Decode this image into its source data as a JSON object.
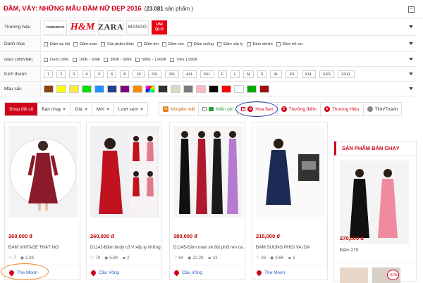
{
  "header": {
    "title": "ĐẦM, VÁY: NHỮNG MẪU ĐẦM NỮ ĐẸP 2016",
    "count_prefix": "(",
    "count": "23.081",
    "count_suffix": " sản phẩm )"
  },
  "filters": {
    "brand": {
      "label": "Thương hiệu",
      "items": [
        "FOREVER 21",
        "H&M",
        "ZARA",
        "MANGO",
        "UNI QLO"
      ]
    },
    "category": {
      "label": "Danh mục",
      "items": [
        "Đầm dạ hội",
        "Đầm maxi",
        "Sản phẩm khác",
        "Đầm ôm",
        "Đầm xòe",
        "Đầm suông",
        "Đầm xếp ly",
        "Đầm denim",
        "Đầm trễ vai"
      ]
    },
    "price": {
      "label": "Giá(x 1000VNĐ)",
      "items": [
        "Dưới 100K",
        "100K - 300K",
        "300K - 500K",
        "500K - 1,000K",
        "Trên 1,000K"
      ]
    },
    "size": {
      "label": "Kích thước",
      "items": [
        "1",
        "2",
        "3",
        "4",
        "5",
        "6",
        "8",
        "10",
        "2XL",
        "3XL",
        "4XL",
        "5XL",
        "F",
        "L",
        "M",
        "S",
        "XL",
        "XS",
        "XXL",
        "XXS",
        "XXXL"
      ]
    },
    "color": {
      "label": "Màu sắc",
      "swatches": [
        "#8b4513",
        "#ffff00",
        "#ffeb3b",
        "#00e000",
        "#1e90ff",
        "#27408b",
        "#800080",
        "#ff8c00",
        "multicolor",
        "#333333",
        "#d8d8c0",
        "#7a7a7a",
        "#ffb6c1",
        "#000000",
        "#ff0000",
        "#ffffff",
        "#00aa00",
        "#a01010"
      ]
    }
  },
  "sort_bar": {
    "items": [
      "Shop đối cũ",
      "Bán chạy",
      "Giá",
      "Mới",
      "Lượt xem"
    ]
  },
  "tag_filters": {
    "items": [
      "Khuyến mãi",
      "Miễn phí",
      "Hoa Sen",
      "Thưởng điểm",
      "Thương Hiệu",
      "Tỉnh/Thành"
    ]
  },
  "products": [
    {
      "price": "260,000 đ",
      "name": "ĐẦM VINTAGE THẮT NƠ",
      "likes": "7",
      "views": "2.3K",
      "comments": "",
      "shop": "The Moon"
    },
    {
      "price": "260,000 đ",
      "name": "D1142-Đầm body cổ V xếp ly những...",
      "likes": "79",
      "views": "5.8K",
      "comments": "2",
      "shop": "Cầu Vồng"
    },
    {
      "price": "380,000 đ",
      "name": "D1145-Đầm maxi xẻ đùi phối ren ca...",
      "likes": "94",
      "views": "22.2K",
      "comments": "13",
      "shop": "Cầu Vồng"
    },
    {
      "price": "215,000 đ",
      "name": "ĐẦM SUÔNG PHỐI VAI DA",
      "likes": "33",
      "views": "3.6K",
      "comments": "1",
      "shop": "The Moon"
    }
  ],
  "sidebar": {
    "title": "SẢN PHẨM BÁN CHẠY",
    "price": "270,000 đ",
    "name": "Đầm 270",
    "badge": "-31%"
  }
}
